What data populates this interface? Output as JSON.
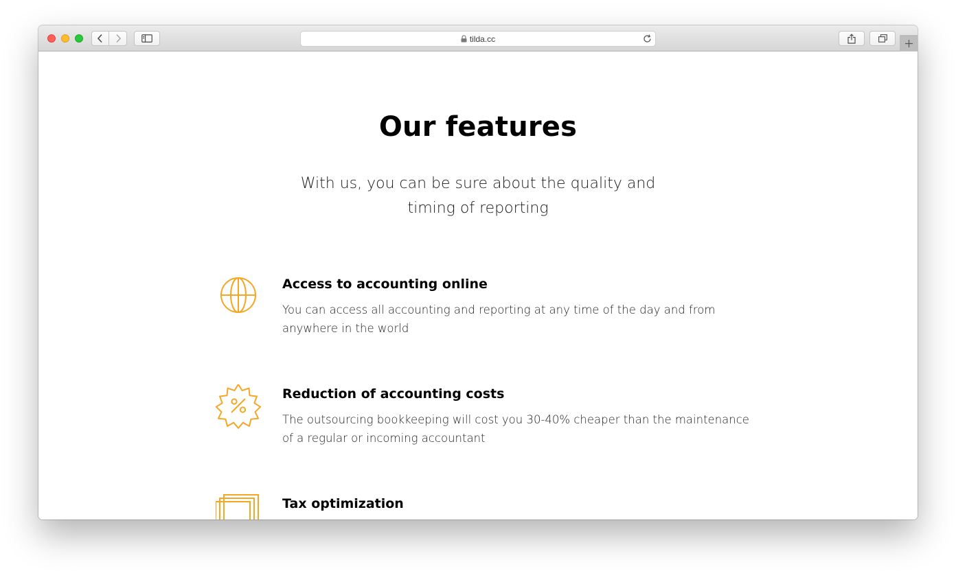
{
  "browser": {
    "url": "tilda.cc",
    "icons": {
      "back": "chevron-left-icon",
      "forward": "chevron-right-icon",
      "sidebar": "sidebar-icon",
      "lock": "lock-icon",
      "reload": "reload-icon",
      "share": "share-icon",
      "tabs": "tabs-icon",
      "new_tab": "plus-icon"
    }
  },
  "page": {
    "title": "Our features",
    "subtitle": "With us, you can be sure about the quality and timing of reporting",
    "accent_color": "#F5A623",
    "features": [
      {
        "icon": "globe-icon",
        "title": "Access to accounting online",
        "text": "You can access all accounting and reporting at any time of the day and from anywhere in the world"
      },
      {
        "icon": "percent-badge-icon",
        "title": "Reduction of accounting costs",
        "text": "The outsourcing bookkeeping will cost you 30-40% cheaper than the maintenance of a regular or incoming accountant"
      },
      {
        "icon": "stacked-cards-icon",
        "title": "Tax optimization",
        "text": ""
      }
    ]
  }
}
